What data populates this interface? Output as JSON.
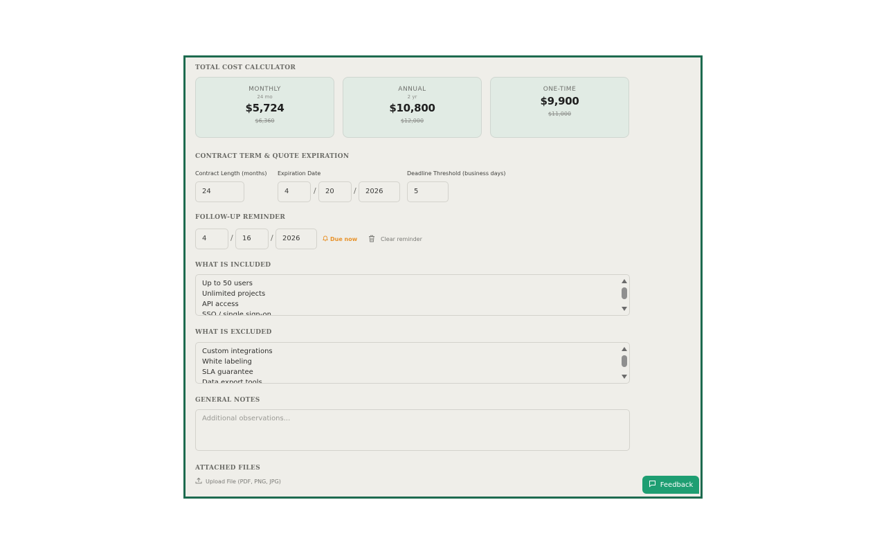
{
  "cost_calculator": {
    "title": "TOTAL COST CALCULATOR",
    "cards": [
      {
        "label": "MONTHLY",
        "sub": "24 mo",
        "price": "$5,724",
        "old_price": "$6,360"
      },
      {
        "label": "ANNUAL",
        "sub": "2 yr",
        "price": "$10,800",
        "old_price": "$12,000"
      },
      {
        "label": "ONE-TIME",
        "sub": "",
        "price": "$9,900",
        "old_price": "$11,000"
      }
    ]
  },
  "contract": {
    "title": "CONTRACT TERM & QUOTE EXPIRATION",
    "length_label": "Contract Length (months)",
    "length_value": "24",
    "expiration_label": "Expiration Date",
    "exp_month": "4",
    "exp_day": "20",
    "exp_year": "2026",
    "threshold_label": "Deadline Threshold (business days)",
    "threshold_value": "5"
  },
  "reminder": {
    "title": "FOLLOW-UP REMINDER",
    "month": "4",
    "day": "16",
    "year": "2026",
    "due_text": "Due now",
    "clear_text": "Clear reminder"
  },
  "included": {
    "title": "WHAT IS INCLUDED",
    "lines": [
      "Up to 50 users",
      "Unlimited projects",
      "API access",
      "SSO / single sign-on"
    ]
  },
  "excluded": {
    "title": "WHAT IS EXCLUDED",
    "lines": [
      "Custom integrations",
      "White labeling",
      "SLA guarantee",
      "Data export tools"
    ]
  },
  "notes": {
    "title": "GENERAL NOTES",
    "placeholder": "Additional observations..."
  },
  "attachments": {
    "title": "ATTACHED FILES",
    "upload_label": "Upload File (PDF, PNG, JPG)"
  },
  "feedback": {
    "label": "Feedback"
  },
  "colors": {
    "frame_border": "#1d6b4f",
    "card_bg": "#e1ebe4",
    "due_accent": "#e8922a",
    "feedback_bg": "#1e9e72"
  },
  "icons": [
    "bell-icon",
    "trash-icon",
    "upload-icon",
    "chat-icon"
  ]
}
